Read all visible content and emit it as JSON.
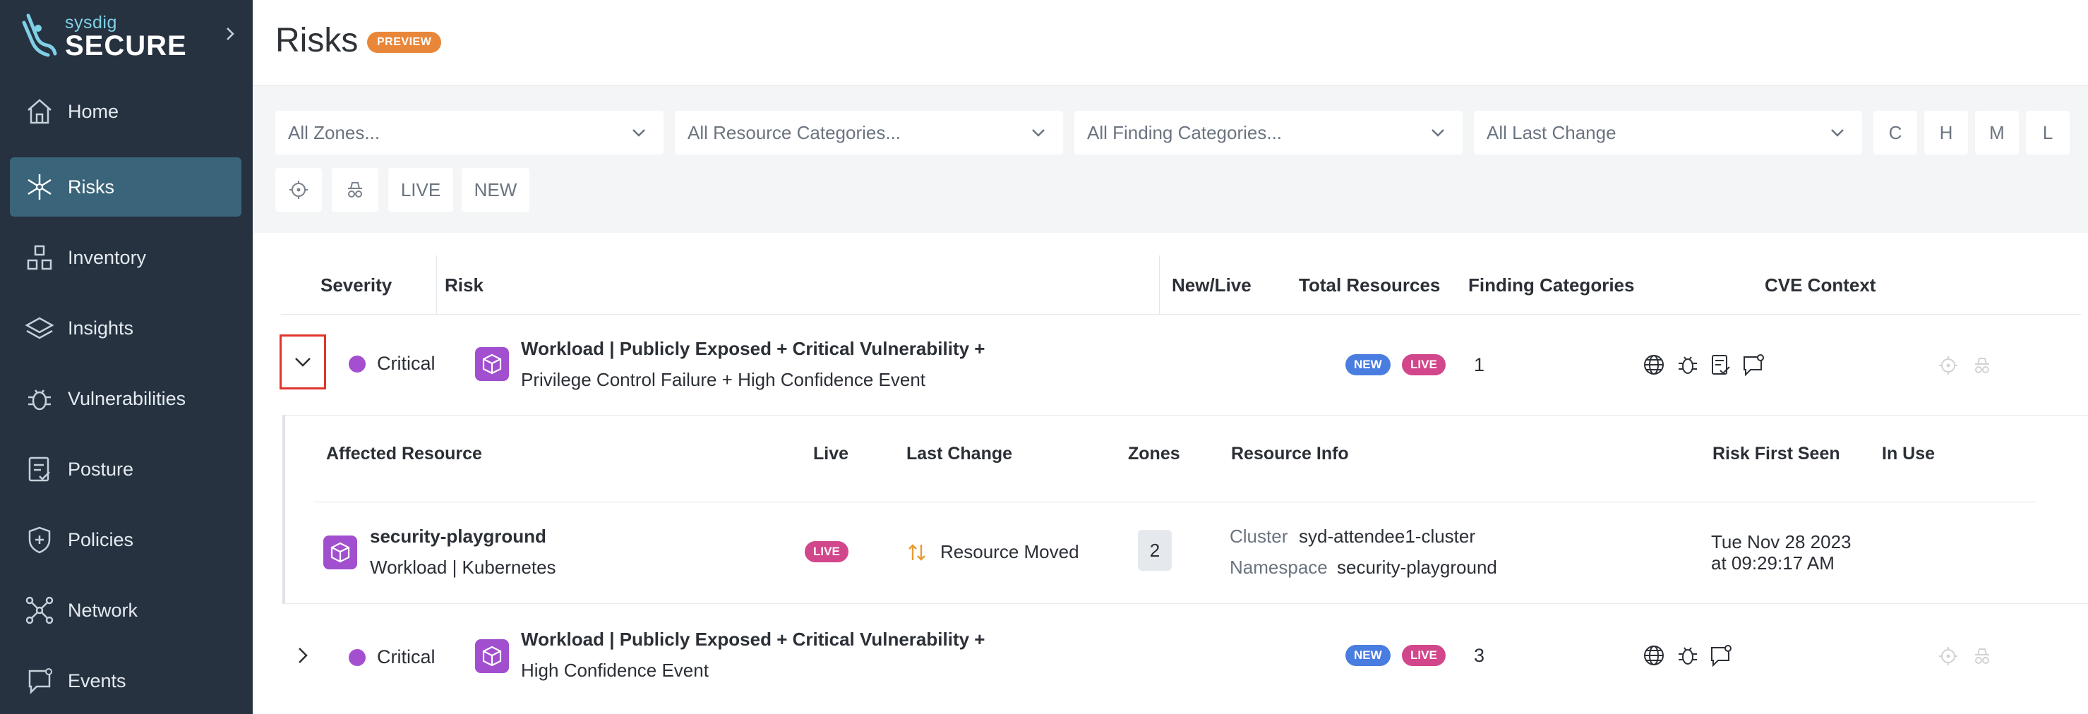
{
  "brand": {
    "small": "sysdig",
    "big": "SECURE"
  },
  "sidebar": {
    "items": [
      {
        "label": "Home",
        "icon": "home-icon"
      },
      {
        "label": "Risks",
        "icon": "risks-icon",
        "active": true
      },
      {
        "label": "Inventory",
        "icon": "inventory-icon"
      },
      {
        "label": "Insights",
        "icon": "insights-icon"
      },
      {
        "label": "Vulnerabilities",
        "icon": "bug-icon"
      },
      {
        "label": "Posture",
        "icon": "posture-icon"
      },
      {
        "label": "Policies",
        "icon": "shield-icon"
      },
      {
        "label": "Network",
        "icon": "network-icon"
      },
      {
        "label": "Events",
        "icon": "events-icon"
      }
    ]
  },
  "header": {
    "title": "Risks",
    "badge": "PREVIEW"
  },
  "filters": {
    "zones": "All Zones...",
    "resource_categories": "All Resource Categories...",
    "finding_categories": "All Finding Categories...",
    "last_change": "All Last Change",
    "severity_buttons": [
      "C",
      "H",
      "M",
      "L"
    ],
    "live_label": "LIVE",
    "new_label": "NEW"
  },
  "table": {
    "headers": {
      "severity": "Severity",
      "risk": "Risk",
      "new_live": "New/Live",
      "total_resources": "Total Resources",
      "finding_categories": "Finding Categories",
      "cve_context": "CVE Context"
    },
    "rows": [
      {
        "severity": "Critical",
        "title": "Workload | Publicly Exposed + Critical Vulnerability +",
        "subtitle": "Privilege Control Failure + High Confidence Event",
        "new_badge": "NEW",
        "live_badge": "LIVE",
        "total": "1",
        "expanded": true
      },
      {
        "severity": "Critical",
        "title": "Workload | Publicly Exposed + Critical Vulnerability +",
        "subtitle": "High Confidence Event",
        "new_badge": "NEW",
        "live_badge": "LIVE",
        "total": "3",
        "expanded": false
      }
    ]
  },
  "details": {
    "headers": {
      "affected_resource": "Affected Resource",
      "live": "Live",
      "last_change": "Last Change",
      "zones": "Zones",
      "resource_info": "Resource Info",
      "risk_first_seen": "Risk First Seen",
      "in_use": "In Use"
    },
    "resource": {
      "name": "security-playground",
      "type": "Workload | Kubernetes",
      "live_badge": "LIVE",
      "last_change": "Resource Moved",
      "zones": "2",
      "cluster_key": "Cluster",
      "cluster_value": "syd-attendee1-cluster",
      "namespace_key": "Namespace",
      "namespace_value": "security-playground",
      "first_seen_line1": "Tue Nov 28 2023",
      "first_seen_line2": "at 09:29:17 AM"
    }
  },
  "colors": {
    "sidebar_bg": "#263240",
    "active_nav": "#3a6479",
    "critical": "#a44fd0",
    "new_badge": "#4a7de0",
    "live_badge": "#d2468c",
    "preview_badge": "#e8873a",
    "highlight_box": "#e0342a"
  }
}
